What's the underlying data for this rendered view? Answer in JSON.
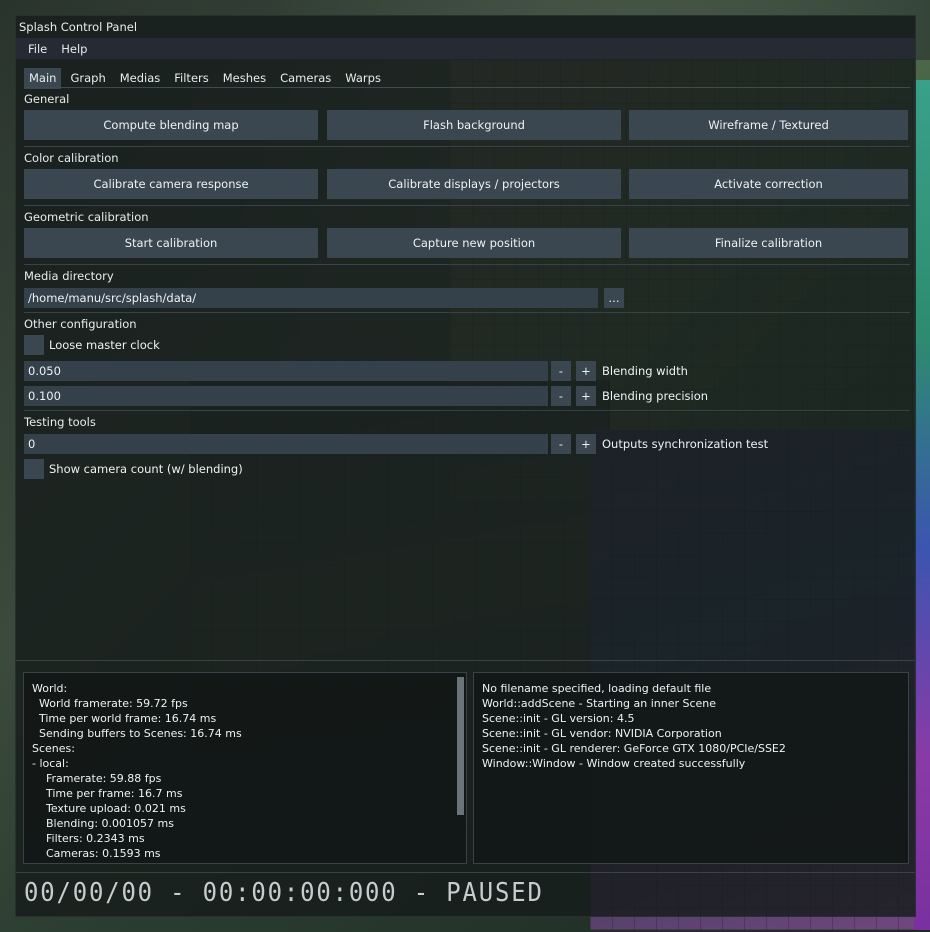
{
  "window": {
    "title": "Splash Control Panel"
  },
  "menu": [
    "File",
    "Help"
  ],
  "tabs": [
    {
      "label": "Main",
      "active": true
    },
    {
      "label": "Graph"
    },
    {
      "label": "Medias"
    },
    {
      "label": "Filters"
    },
    {
      "label": "Meshes"
    },
    {
      "label": "Cameras"
    },
    {
      "label": "Warps"
    }
  ],
  "general": {
    "title": "General",
    "buttons": [
      "Compute blending map",
      "Flash background",
      "Wireframe / Textured"
    ]
  },
  "color_calibration": {
    "title": "Color calibration",
    "buttons": [
      "Calibrate camera response",
      "Calibrate displays / projectors",
      "Activate correction"
    ]
  },
  "geometric_calibration": {
    "title": "Geometric calibration",
    "buttons": [
      "Start calibration",
      "Capture new position",
      "Finalize calibration"
    ]
  },
  "media_directory": {
    "title": "Media directory",
    "value": "/home/manu/src/splash/data/",
    "browse_label": "..."
  },
  "other_configuration": {
    "title": "Other configuration",
    "loose_master_clock": "Loose master clock",
    "blending_width": {
      "value": "0.050",
      "label": "Blending width"
    },
    "blending_precision": {
      "value": "0.100",
      "label": "Blending precision"
    },
    "minus": "-",
    "plus": "+"
  },
  "testing_tools": {
    "title": "Testing tools",
    "sync_test": {
      "value": "0",
      "label": "Outputs synchronization test"
    },
    "show_camera_count": "Show camera count (w/ blending)"
  },
  "stats": [
    "World:",
    "  World framerate: 59.72 fps",
    "  Time per world frame: 16.74 ms",
    "  Sending buffers to Scenes: 16.74 ms",
    "Scenes:",
    "- local:",
    "    Framerate: 59.88 fps",
    "    Time per frame: 16.7 ms",
    "    Texture upload: 0.021 ms",
    "    Blending: 0.001057 ms",
    "    Filters: 0.2343 ms",
    "    Cameras: 0.1593 ms"
  ],
  "log": [
    "No filename specified, loading default file",
    "World::addScene - Starting an inner Scene",
    "Scene::init - GL version: 4.5",
    "Scene::init - GL vendor: NVIDIA Corporation",
    "Scene::init - GL renderer: GeForce GTX 1080/PCIe/SSE2",
    "Window::Window - Window created successfully"
  ],
  "clock": "00/00/00 - 00:00:00:000 - PAUSED"
}
